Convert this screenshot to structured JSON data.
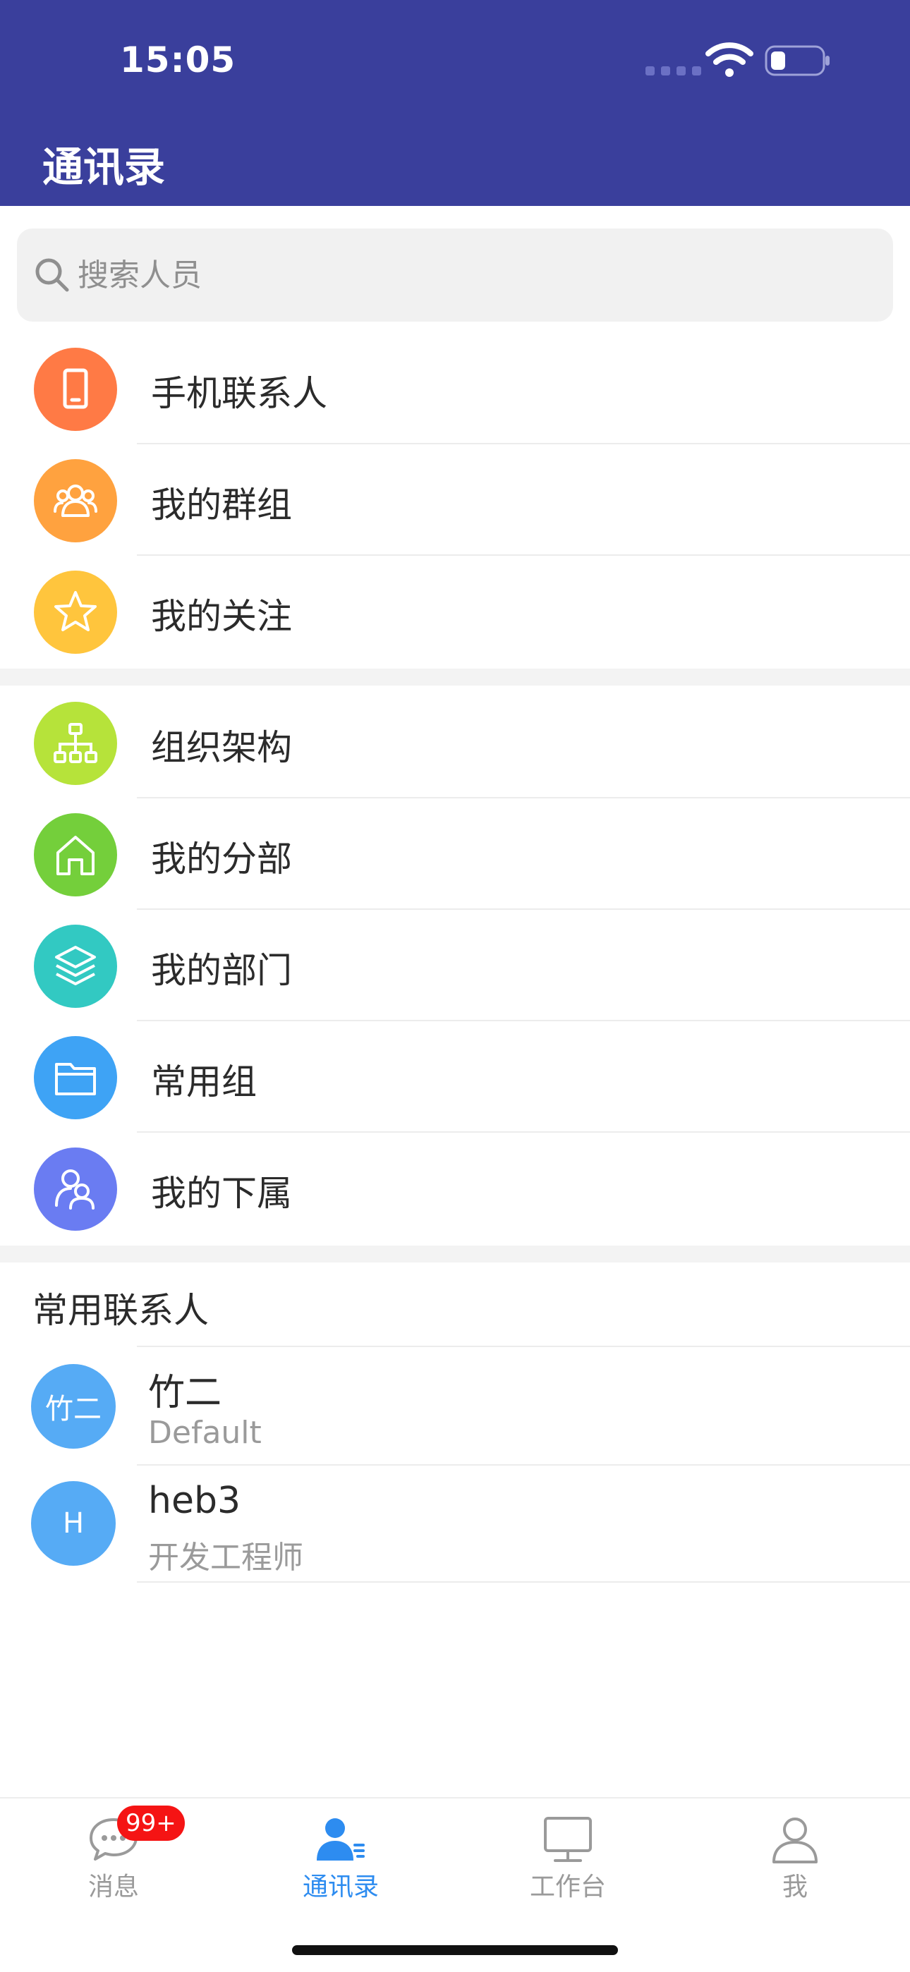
{
  "status_bar": {
    "time": "15:05"
  },
  "header": {
    "title": "通讯录"
  },
  "search": {
    "placeholder": "搜索人员"
  },
  "menu_groups": [
    [
      {
        "label": "手机联系人",
        "icon": "phone-icon",
        "color": "#ff7a45"
      },
      {
        "label": "我的群组",
        "icon": "group-icon",
        "color": "#ffa23f"
      },
      {
        "label": "我的关注",
        "icon": "star-icon",
        "color": "#ffc53d"
      }
    ],
    [
      {
        "label": "组织架构",
        "icon": "org-chart-icon",
        "color": "#b6e33a"
      },
      {
        "label": "我的分部",
        "icon": "home-icon",
        "color": "#74cf3b"
      },
      {
        "label": "我的部门",
        "icon": "layers-icon",
        "color": "#32c9c2"
      },
      {
        "label": "常用组",
        "icon": "folder-icon",
        "color": "#3ea3f5"
      },
      {
        "label": "我的下属",
        "icon": "subordinate-icon",
        "color": "#6a7cf2"
      }
    ]
  ],
  "frequent_contacts": {
    "title": "常用联系人",
    "items": [
      {
        "avatar_text": "竹二",
        "name": "竹二",
        "subtitle": "Default"
      },
      {
        "avatar_text": "H",
        "name": "heb3",
        "subtitle": "开发工程师"
      }
    ]
  },
  "tabbar": {
    "items": [
      {
        "label": "消息",
        "icon": "chat-icon",
        "badge": "99+"
      },
      {
        "label": "通讯录",
        "icon": "contacts-icon",
        "active": true
      },
      {
        "label": "工作台",
        "icon": "monitor-icon"
      },
      {
        "label": "我",
        "icon": "user-icon"
      }
    ]
  },
  "colors": {
    "header": "#3a3f9c",
    "active_tab": "#2d8cf0",
    "badge": "#f51414",
    "avatar": "#56abf5"
  }
}
